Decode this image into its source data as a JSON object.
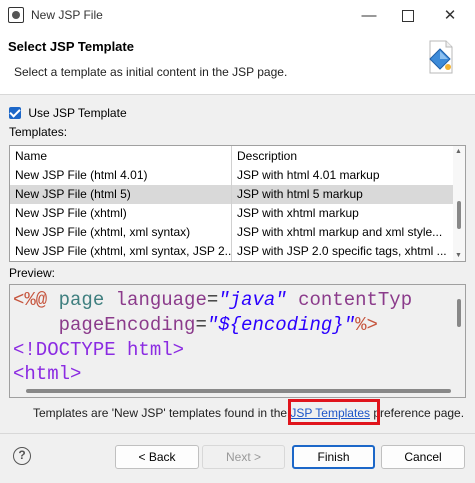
{
  "window": {
    "title": "New JSP File",
    "minimize_glyph": "—",
    "close_glyph": "✕"
  },
  "header": {
    "title": "Select JSP Template",
    "description": "Select a template as initial content in the JSP page."
  },
  "use_template": {
    "label": "Use JSP Template",
    "checked": true
  },
  "templates": {
    "label": "Templates:",
    "columns": [
      "Name",
      "Description"
    ],
    "rows": [
      {
        "name": "New JSP File (html 4.01)",
        "description": "JSP with html 4.01 markup",
        "selected": false
      },
      {
        "name": "New JSP File (html 5)",
        "description": "JSP with html 5 markup",
        "selected": true
      },
      {
        "name": "New JSP File (xhtml)",
        "description": "JSP with xhtml markup",
        "selected": false
      },
      {
        "name": "New JSP File (xhtml, xml syntax)",
        "description": "JSP with xhtml markup and xml style...",
        "selected": false
      },
      {
        "name": "New JSP File (xhtml, xml syntax, JSP 2...",
        "description": "JSP with JSP 2.0 specific tags, xhtml ...",
        "selected": false
      }
    ]
  },
  "preview": {
    "label": "Preview:",
    "line1": {
      "open": "<%@",
      "directive": "page",
      "attr1": "language",
      "eq": "=",
      "val1": "\"java\"",
      "attr2": "contentTyp"
    },
    "line2": {
      "attr": "pageEncoding",
      "eq": "=",
      "q_open": "\"",
      "val": "${encoding}",
      "q_close": "\"",
      "close": "%>"
    },
    "line3": "<!DOCTYPE html>",
    "line4": "<html>"
  },
  "footer_note": {
    "before": "Templates are 'New JSP' templates found in the ",
    "link": "JSP Templates",
    "after": " preference page."
  },
  "buttons": {
    "help": "?",
    "back": "< Back",
    "next": "Next >",
    "finish": "Finish",
    "cancel": "Cancel"
  },
  "colors": {
    "accent": "#1c67c8",
    "highlight": "#e0141c",
    "link": "#1c55c8"
  }
}
